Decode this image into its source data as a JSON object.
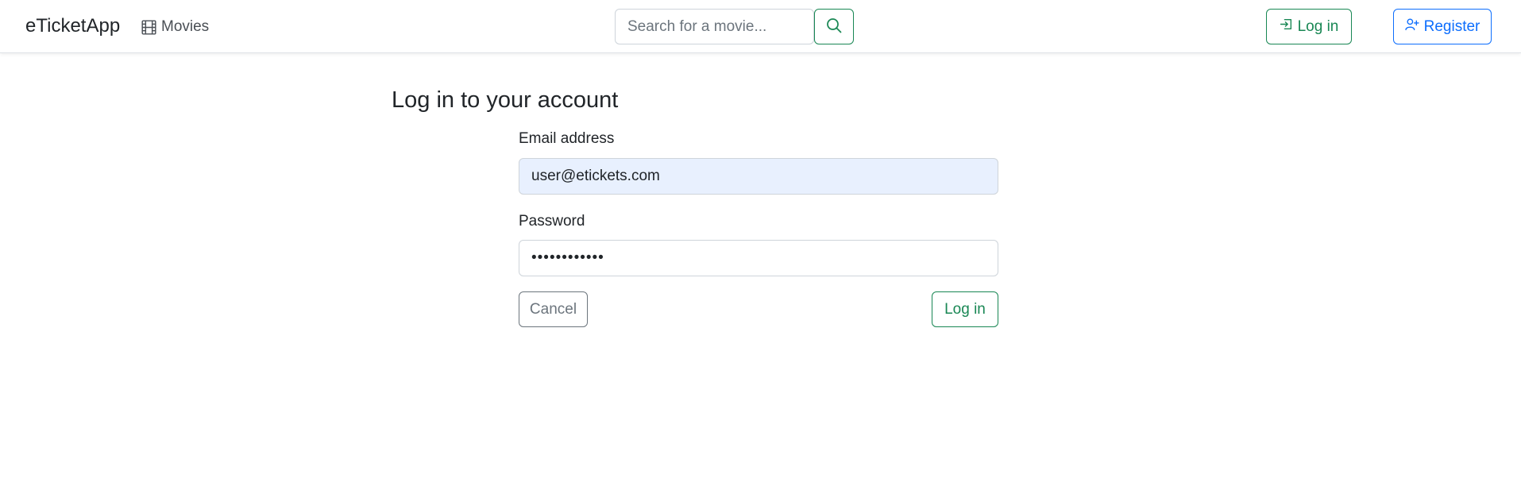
{
  "navbar": {
    "brand": "eTicketApp",
    "movies_link": {
      "label": "Movies",
      "icon": "film-icon"
    },
    "search": {
      "placeholder": "Search for a movie...",
      "value": "",
      "button_icon": "search-icon"
    },
    "login_button": {
      "label": "Log in",
      "icon": "box-arrow-in-right-icon"
    },
    "register_button": {
      "label": "Register",
      "icon": "person-plus-icon"
    }
  },
  "login_form": {
    "title": "Log in to your account",
    "email": {
      "label": "Email address",
      "value": "user@etickets.com"
    },
    "password": {
      "label": "Password",
      "value": "••••••••••••"
    },
    "cancel_label": "Cancel",
    "submit_label": "Log in"
  },
  "colors": {
    "success": "#198754",
    "primary": "#0d6efd",
    "secondary": "#6c757d",
    "autofill_background": "#e8f0fe"
  }
}
